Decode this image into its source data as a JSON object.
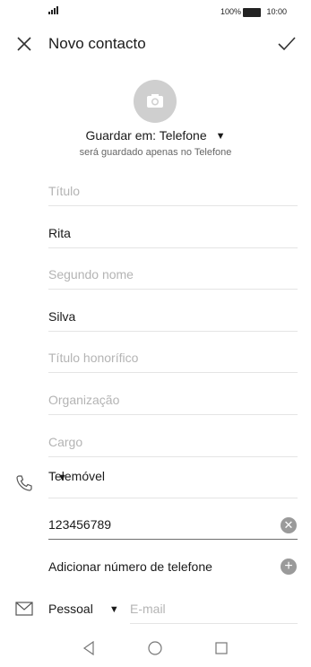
{
  "status_bar": {
    "battery_percent": "100%",
    "time": "10:00"
  },
  "header": {
    "title": "Novo contacto"
  },
  "save_location": {
    "label": "Guardar em: Telefone",
    "subtitle": "será guardado apenas no Telefone"
  },
  "fields": {
    "title_placeholder": "Título",
    "first_name": "Rita",
    "middle_name_placeholder": "Segundo nome",
    "last_name": "Silva",
    "honorific_placeholder": "Título honorífico",
    "organization_placeholder": "Organização",
    "job_placeholder": "Cargo"
  },
  "phone": {
    "type": "Telemóvel",
    "number": "123456789",
    "add_label": "Adicionar número de telefone"
  },
  "email": {
    "type": "Pessoal",
    "placeholder": "E-mail"
  },
  "colors": {
    "text": "#1a1a1a",
    "placeholder": "#b4b4b4",
    "icon_grey": "#9a9a9a",
    "divider": "#e4e4e4"
  }
}
